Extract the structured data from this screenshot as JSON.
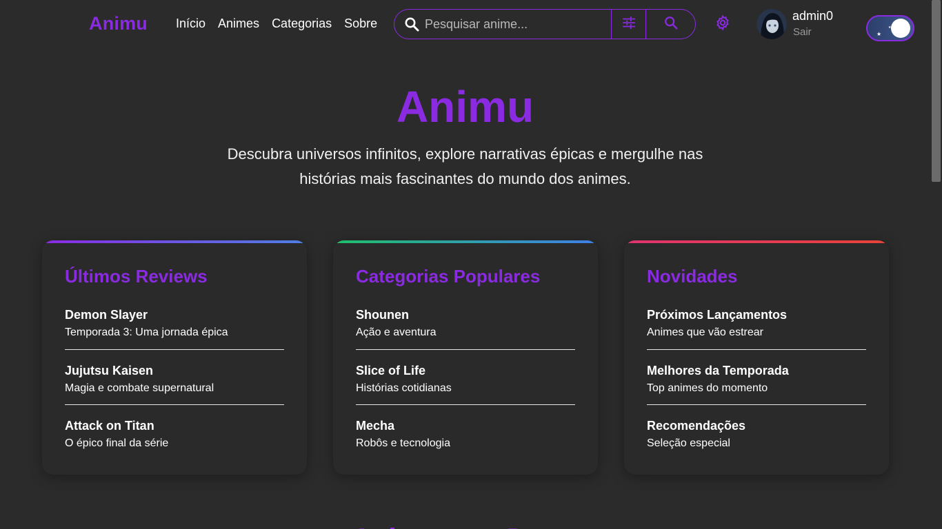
{
  "header": {
    "logo": "Animu",
    "nav": [
      "Início",
      "Animes",
      "Categorias",
      "Sobre"
    ],
    "search_placeholder": "Pesquisar anime...",
    "user_name": "admin0",
    "logout_label": "Sair"
  },
  "hero": {
    "title": "Animu",
    "subtitle": "Descubra universos infinitos, explore narrativas épicas e mergulhe nas histórias mais fascinantes do mundo dos animes."
  },
  "cards": [
    {
      "title": "Últimos Reviews",
      "bar_colors": [
        "#8a2be2",
        "#4f7fe6"
      ],
      "items": [
        {
          "title": "Demon Slayer",
          "subtitle": "Temporada 3: Uma jornada épica"
        },
        {
          "title": "Jujutsu Kaisen",
          "subtitle": "Magia e combate supernatural"
        },
        {
          "title": "Attack on Titan",
          "subtitle": "O épico final da série"
        }
      ]
    },
    {
      "title": "Categorias Populares",
      "bar_colors": [
        "#1fbf6a",
        "#3f7fe8"
      ],
      "items": [
        {
          "title": "Shounen",
          "subtitle": "Ação e aventura"
        },
        {
          "title": "Slice of Life",
          "subtitle": "Histórias cotidianas"
        },
        {
          "title": "Mecha",
          "subtitle": "Robôs e tecnologia"
        }
      ]
    },
    {
      "title": "Novidades",
      "bar_colors": [
        "#e0336f",
        "#e8433a"
      ],
      "items": [
        {
          "title": "Próximos Lançamentos",
          "subtitle": "Animes que vão estrear"
        },
        {
          "title": "Melhores da Temporada",
          "subtitle": "Top animes do momento"
        },
        {
          "title": "Recomendações",
          "subtitle": "Seleção especial"
        }
      ]
    }
  ],
  "section_peek_title": "Animes em D",
  "colors": {
    "accent": "#8a2be2",
    "background": "#2b2b2b"
  }
}
